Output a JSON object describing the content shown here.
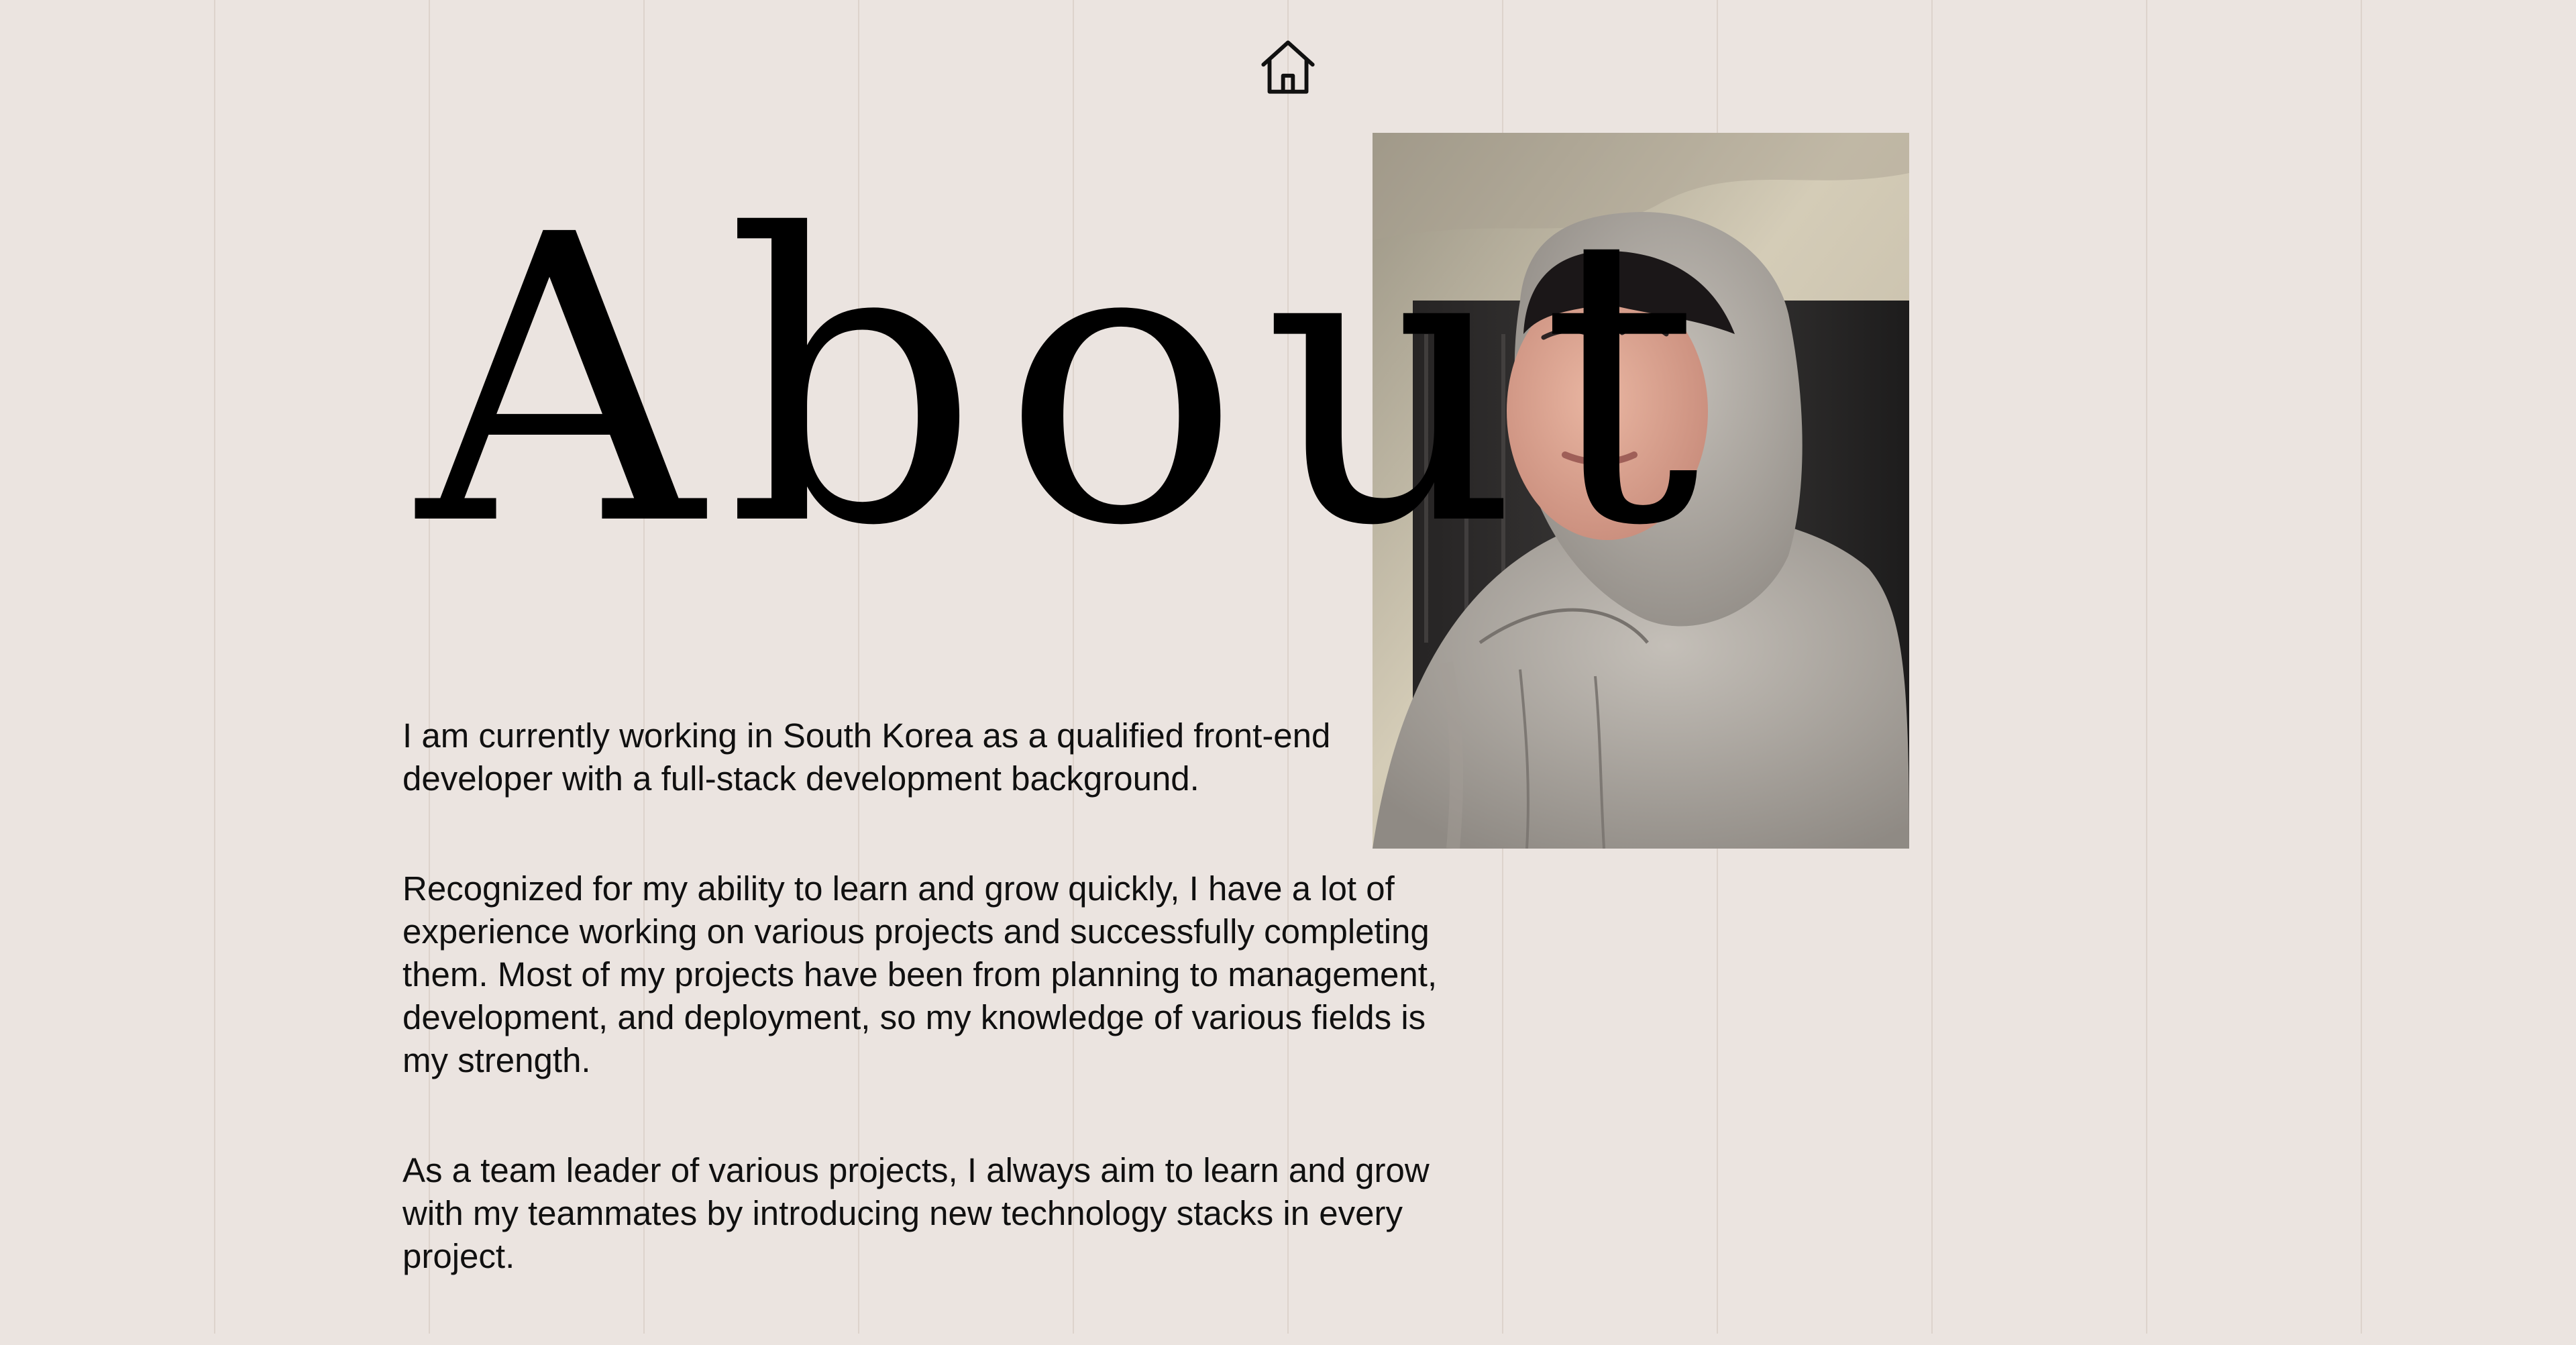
{
  "nav": {
    "home_icon": "home-icon"
  },
  "page": {
    "title": "About"
  },
  "profile": {
    "photo": "portrait-photo"
  },
  "content": {
    "paragraphs": [
      "I am currently working in South Korea as a qualified front-end developer with a full-stack development background.",
      "Recognized for my ability to learn and grow quickly, I have a lot of experience working on various projects and successfully completing them. Most of my projects have been from planning to management, development, and deployment, so my knowledge of various fields is my strength.",
      "As a team leader of various projects, I always aim to learn and grow with my teammates by introducing new technology stacks in every project."
    ]
  },
  "colors": {
    "background": "#ebe4e0",
    "text": "#0a0a0a",
    "grid_line": "#d8cfc6"
  }
}
